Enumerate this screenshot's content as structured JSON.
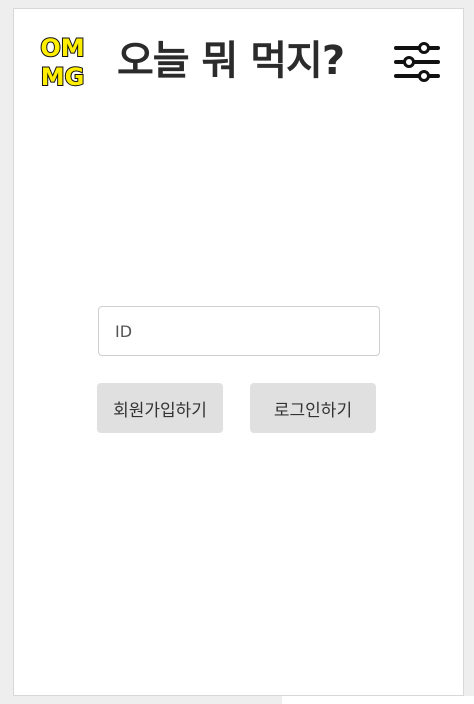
{
  "header": {
    "logo_text_top": "OM",
    "logo_text_bottom": "MG",
    "title": "오늘 뭐 먹지?",
    "filter_icon": "sliders-icon"
  },
  "login_form": {
    "id_placeholder": "ID",
    "id_value": "",
    "signup_label": "회원가입하기",
    "login_label": "로그인하기"
  },
  "colors": {
    "logo_yellow": "#ffee00",
    "logo_outline": "#111111",
    "title_text": "#2b2b2b",
    "button_bg": "#e0e0e0"
  }
}
